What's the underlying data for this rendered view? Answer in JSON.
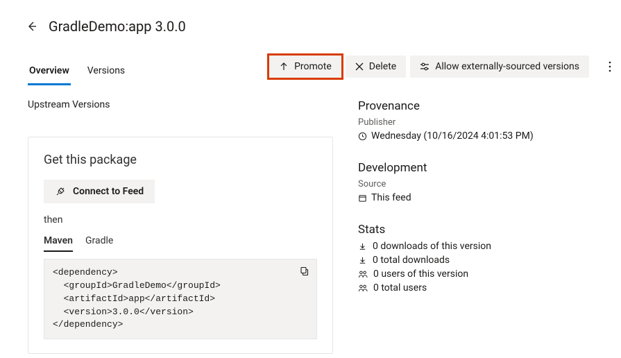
{
  "header": {
    "title": "GradleDemo:app 3.0.0"
  },
  "tabs": {
    "overview": "Overview",
    "versions": "Versions",
    "active": "overview"
  },
  "actions": {
    "promote": "Promote",
    "delete": "Delete",
    "allow_external": "Allow externally-sourced versions"
  },
  "upstream_heading": "Upstream Versions",
  "get_package": {
    "title": "Get this package",
    "connect_label": "Connect to Feed",
    "then": "then",
    "code_tabs": {
      "maven": "Maven",
      "gradle": "Gradle",
      "active": "maven"
    },
    "maven_snippet": "<dependency>\n  <groupId>GradleDemo</groupId>\n  <artifactId>app</artifactId>\n  <version>3.0.0</version>\n</dependency>"
  },
  "provenance": {
    "title": "Provenance",
    "publisher_label": "Publisher",
    "published": "Wednesday (10/16/2024 4:01:53 PM)"
  },
  "development": {
    "title": "Development",
    "source_label": "Source",
    "source_value": "This feed"
  },
  "stats": {
    "title": "Stats",
    "downloads_version": "0 downloads of this version",
    "downloads_total": "0 total downloads",
    "users_version": "0 users of this version",
    "users_total": "0 total users"
  }
}
